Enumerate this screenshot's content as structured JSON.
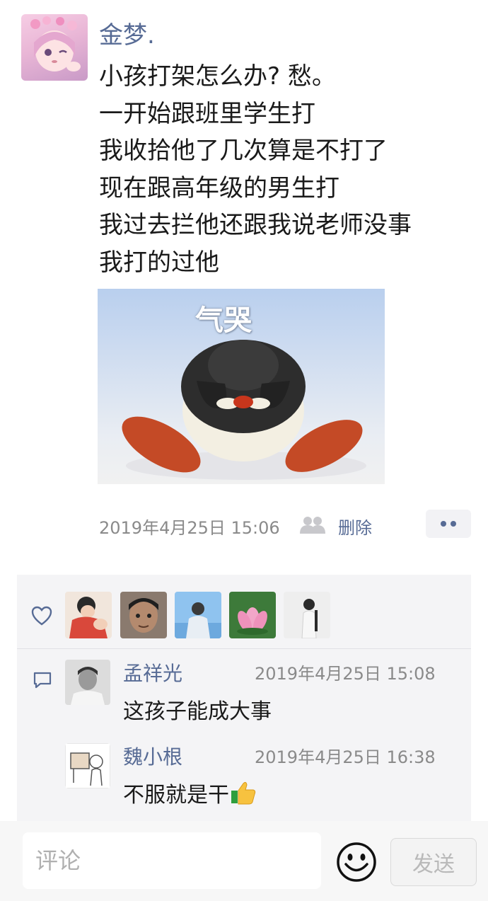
{
  "post": {
    "author": "金梦.",
    "lines": [
      "小孩打架怎么办? 愁。",
      "一开始跟班里学生打",
      "我收拾他了几次算是不打了",
      "现在跟高年级的男生打",
      "我过去拦他还跟我说老师没事",
      "我打的过他"
    ],
    "sticker_caption": "气哭",
    "time": "2019年4月25日 15:06",
    "delete_label": "删除"
  },
  "likes": {
    "icon": "heart-outline-icon",
    "count_shown": 5
  },
  "comments": [
    {
      "name": "孟祥光",
      "time": "2019年4月25日 15:08",
      "text": "这孩子能成大事"
    },
    {
      "name": "魏小根",
      "time": "2019年4月25日 16:38",
      "text": "不服就是干"
    }
  ],
  "composer": {
    "placeholder": "评论",
    "send_label": "发送"
  },
  "colors": {
    "link": "#576b95",
    "meta": "#8a8a8a",
    "panel": "#f4f4f6"
  }
}
